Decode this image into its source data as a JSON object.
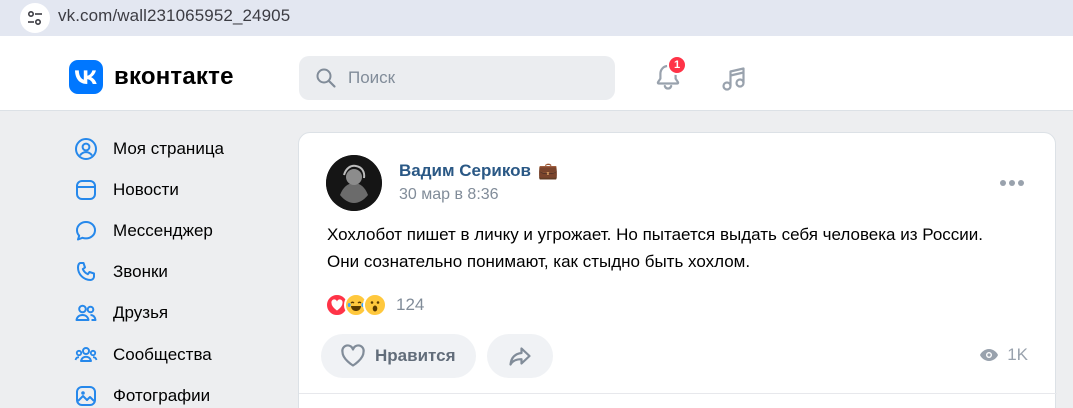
{
  "browser": {
    "url": "vk.com/wall231065952_24905"
  },
  "header": {
    "logo_badge": "VK",
    "logo_text": "вконтакте",
    "search_placeholder": "Поиск",
    "notifications_count": "1",
    "accent_color": "#0077ff",
    "badge_color": "#ff3347"
  },
  "nav": {
    "items": [
      {
        "label": "Моя страница",
        "icon": "user-circle-icon"
      },
      {
        "label": "Новости",
        "icon": "news-icon"
      },
      {
        "label": "Мессенджер",
        "icon": "chat-bubble-icon"
      },
      {
        "label": "Звонки",
        "icon": "phone-icon"
      },
      {
        "label": "Друзья",
        "icon": "friends-icon"
      },
      {
        "label": "Сообщества",
        "icon": "communities-icon"
      },
      {
        "label": "Фотографии",
        "icon": "photos-icon"
      }
    ]
  },
  "post": {
    "author": "Вадим Сериков",
    "author_badge": "💼",
    "date": "30 мар в 8:36",
    "text": "Хохлобот пишет в личку и угрожает. Но пытается выдать себя человека из России. Они сознательно понимают, как стыдно быть хохлом.",
    "reactions": [
      "heart",
      "laughing-tears",
      "surprised"
    ],
    "reactions_count": "124",
    "like_label": "Нравится",
    "views": "1K",
    "author_color": "#2a5885"
  }
}
